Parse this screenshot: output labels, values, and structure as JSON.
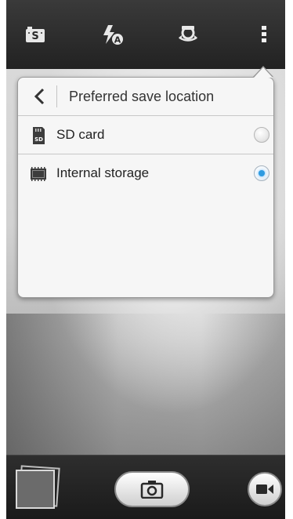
{
  "topbar": {
    "icons": [
      "shooting-mode-icon",
      "flash-auto-icon",
      "switch-camera-icon",
      "more-options-icon"
    ]
  },
  "popup": {
    "title": "Preferred save location",
    "back_icon": "chevron-left-icon",
    "options": [
      {
        "label": "SD card",
        "icon": "sd-card-icon",
        "selected": false
      },
      {
        "label": "Internal storage",
        "icon": "memory-chip-icon",
        "selected": true
      }
    ]
  },
  "bottombar": {
    "icons": [
      "gallery-thumbnail",
      "camera-shutter-icon",
      "video-record-icon"
    ]
  },
  "colors": {
    "radio_selected": "#2f9be0",
    "popup_background": "#f6f6f6",
    "bar_background": "#2a2a2a"
  }
}
